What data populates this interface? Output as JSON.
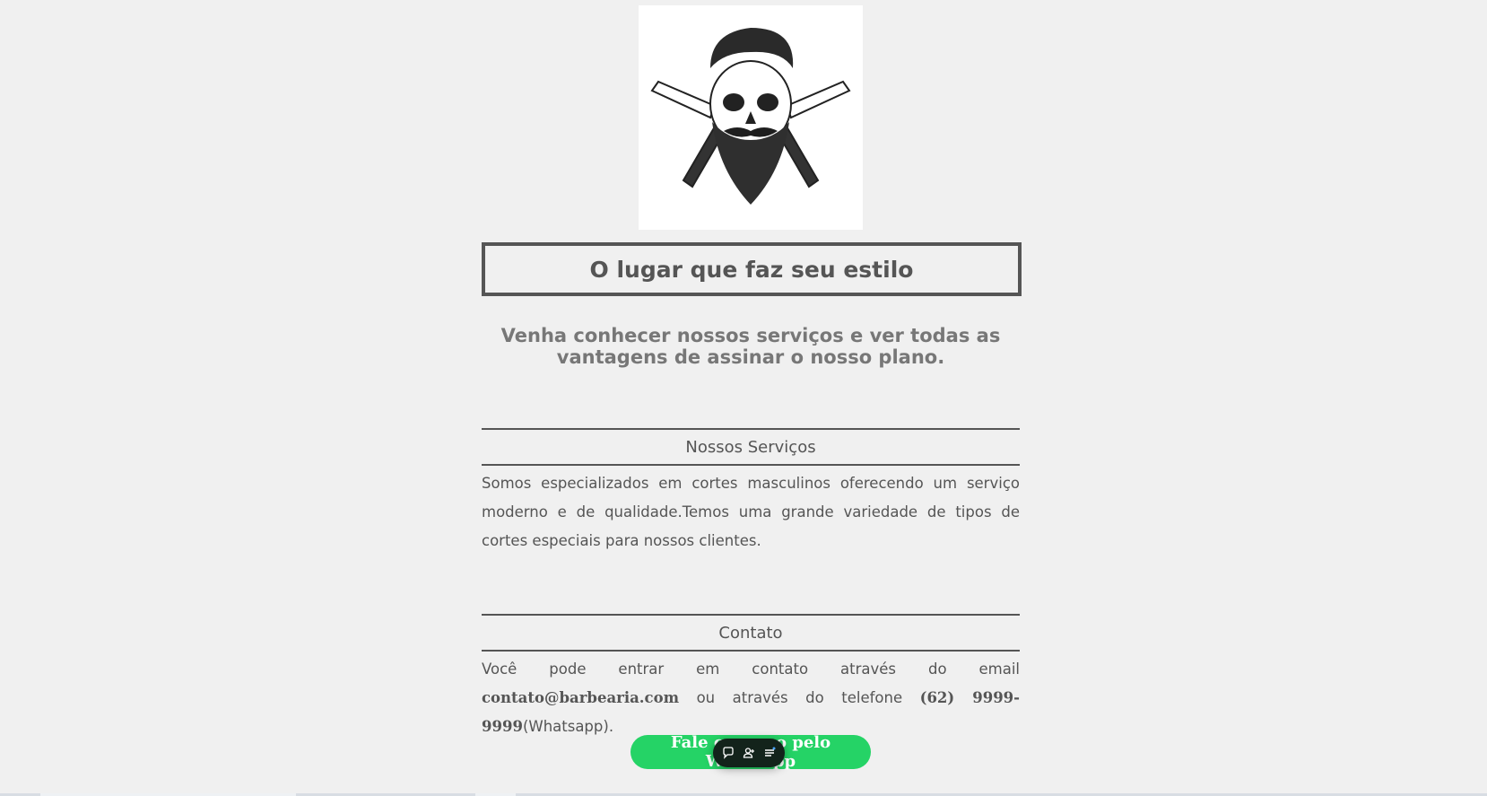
{
  "headline": "O lugar que faz seu estilo",
  "subheadline": "Venha conhecer nossos serviços e ver todas as vantagens de assinar o nosso plano.",
  "services": {
    "title": "Nossos Serviços",
    "text": "Somos especializados em cortes masculinos oferecendo um serviço moderno e de qualidade.Temos uma grande variedade de tipos de cortes especiais para nossos clientes."
  },
  "contact": {
    "title": "Contato",
    "text_before_email": "Você pode entrar em contato através do email ",
    "email": "contato@barbearia.com",
    "text_before_phone": " ou através do telefone ",
    "phone": "(62) 9999-9999",
    "text_after_phone": "(Whatsapp)."
  },
  "whatsapp_button": {
    "label": "Fale conosco pelo Whatsapp"
  },
  "colors": {
    "accent": "#25d366",
    "text": "#555555",
    "background": "#f0f0f0"
  },
  "icons": {
    "logo": "skull-beard-razors-logo",
    "toolbar": [
      "chat-bubble-icon",
      "add-person-icon",
      "list-icon"
    ]
  }
}
